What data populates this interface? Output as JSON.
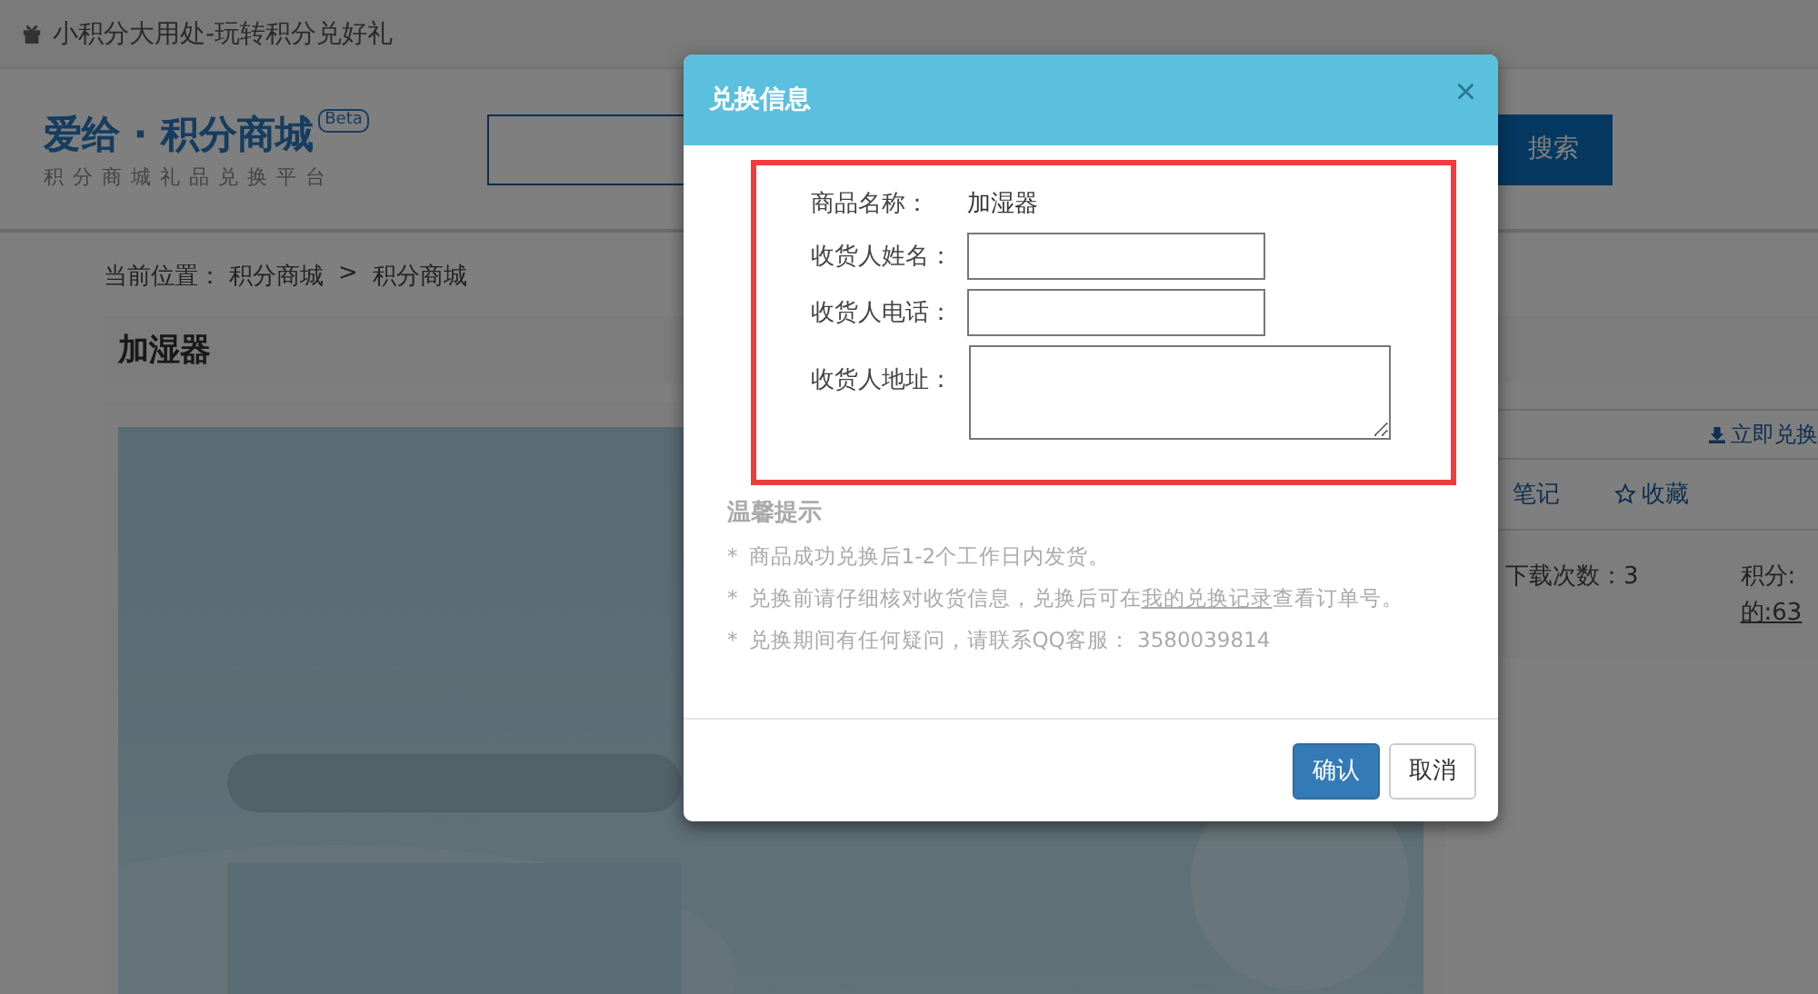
{
  "top_bar": {
    "text": "小积分大用处-玩转积分兑好礼"
  },
  "header": {
    "logo_title": "爱给 · 积分商城",
    "logo_badge": "Beta",
    "logo_subtitle": "积分商城礼品兑换平台",
    "search_button": "搜索"
  },
  "breadcrumb": {
    "label": "当前位置：",
    "separator": ">",
    "links": [
      "积分商城",
      "积分商城"
    ]
  },
  "product": {
    "title": "加湿器"
  },
  "side_panel": {
    "exchange_link": "立即兑换",
    "tabs": [
      {
        "label": "笔记",
        "kind": "plain"
      },
      {
        "label": "收藏",
        "kind": "star"
      }
    ],
    "stats": [
      {
        "text": "下载次数：3"
      },
      {
        "text": "积分:"
      }
    ],
    "stat_link": "的:63"
  },
  "dialog": {
    "title": "兑换信息",
    "close": "×",
    "fields": [
      {
        "kind": "text",
        "label": "商品名称：",
        "value": "加湿器"
      },
      {
        "kind": "input",
        "label": "收货人姓名："
      },
      {
        "kind": "input",
        "label": "收货人电话："
      },
      {
        "kind": "textarea",
        "label": "收货人地址："
      }
    ],
    "tips_title": "温馨提示",
    "tips": [
      {
        "bullet": "*",
        "text": "商品成功兑换后1-2个工作日内发货。"
      },
      {
        "bullet": "*",
        "text": "兑换前请仔细核对收货信息，兑换后可在",
        "link": "我的兑换记录",
        "after": "查看订单号。"
      },
      {
        "bullet": "*",
        "text": "兑换期间有任何疑问，请联系QQ客服： 3580039814"
      }
    ],
    "buttons": [
      {
        "label": "确认",
        "kind": "primary"
      },
      {
        "label": "取消",
        "kind": "default"
      }
    ]
  }
}
